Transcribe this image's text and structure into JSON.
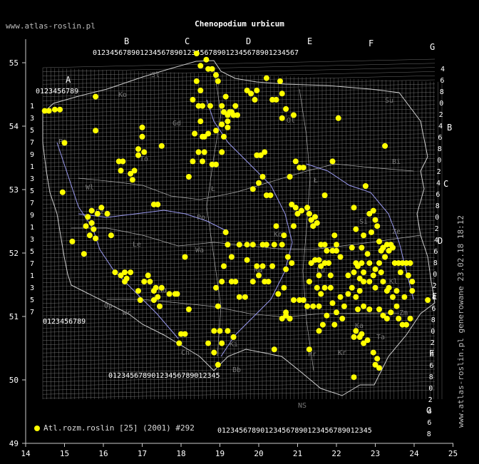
{
  "header": {
    "title": "Chenopodium urbicum",
    "site": "www.atlas-roslin.pl"
  },
  "side_note": "www.atlas-roslin.pl generowane 23.02.18 18:12",
  "legend": {
    "label": "Atl.rozm.roslin [25] (2001) #292"
  },
  "colors": {
    "point": "#ffff00",
    "grid": "#888888",
    "border": "#cccccc",
    "river": "#9999ee",
    "background": "#000000"
  },
  "axes": {
    "x_ticks": [
      "14",
      "15",
      "16",
      "17",
      "18",
      "19",
      "20",
      "21",
      "22",
      "23",
      "24",
      "25"
    ],
    "y_ticks": [
      "55",
      "54",
      "53",
      "52",
      "51",
      "50",
      "49"
    ]
  },
  "grid_letters": {
    "top": [
      "A",
      "B",
      "C",
      "D",
      "E",
      "F",
      "G"
    ],
    "right": [
      "B",
      "C",
      "D",
      "E",
      "F",
      "G"
    ],
    "digit_row": "0123456789"
  },
  "region_labels": [
    "Sl",
    "Ko",
    "Su",
    "Ol",
    "Gd",
    "To",
    "Bi",
    "Wl",
    "Ł",
    "Ł",
    "Po",
    "Ko",
    "Le",
    "Wa",
    "Ra",
    "Lu",
    "Kl",
    "Op",
    "Wr",
    "Ki",
    "Kr",
    "Zm",
    "NS",
    "Bb",
    "Sz",
    "Pi",
    "Si",
    "Ze",
    "Ka",
    "Ta",
    "Pr",
    "Ch",
    "Na"
  ],
  "map_data": {
    "species": "Chenopodium urbicum",
    "points": [
      [
        14.49,
        54.22
      ],
      [
        14.6,
        54.22
      ],
      [
        14.75,
        54.24
      ],
      [
        14.88,
        54.24
      ],
      [
        15.8,
        54.45
      ],
      [
        15.8,
        53.9
      ],
      [
        15.0,
        53.7
      ],
      [
        14.95,
        52.9
      ],
      [
        15.2,
        52.1
      ],
      [
        15.5,
        51.9
      ],
      [
        15.6,
        52.5
      ],
      [
        15.7,
        52.6
      ],
      [
        15.7,
        52.4
      ],
      [
        15.75,
        52.3
      ],
      [
        15.85,
        52.55
      ],
      [
        15.95,
        52.65
      ],
      [
        15.65,
        52.2
      ],
      [
        15.8,
        52.15
      ],
      [
        16.1,
        52.55
      ],
      [
        16.2,
        52.2
      ],
      [
        15.55,
        52.35
      ],
      [
        16.4,
        53.4
      ],
      [
        16.5,
        53.4
      ],
      [
        16.45,
        53.25
      ],
      [
        16.7,
        53.2
      ],
      [
        16.8,
        53.25
      ],
      [
        16.75,
        53.1
      ],
      [
        16.9,
        53.6
      ],
      [
        16.9,
        53.5
      ],
      [
        17.0,
        53.8
      ],
      [
        17.0,
        53.95
      ],
      [
        17.05,
        53.55
      ],
      [
        17.3,
        52.7
      ],
      [
        17.4,
        52.7
      ],
      [
        17.5,
        53.65
      ],
      [
        16.3,
        51.6
      ],
      [
        16.45,
        51.55
      ],
      [
        16.55,
        51.6
      ],
      [
        16.7,
        51.6
      ],
      [
        16.55,
        51.45
      ],
      [
        16.6,
        51.5
      ],
      [
        16.9,
        51.3
      ],
      [
        16.95,
        51.15
      ],
      [
        17.05,
        51.45
      ],
      [
        17.15,
        51.55
      ],
      [
        17.2,
        51.45
      ],
      [
        17.3,
        51.3
      ],
      [
        17.35,
        51.35
      ],
      [
        17.4,
        51.2
      ],
      [
        17.5,
        51.35
      ],
      [
        17.7,
        51.25
      ],
      [
        17.85,
        51.25
      ],
      [
        17.9,
        51.25
      ],
      [
        17.3,
        51.15
      ],
      [
        17.45,
        51.05
      ],
      [
        18.0,
        50.6
      ],
      [
        18.1,
        50.6
      ],
      [
        17.95,
        50.45
      ],
      [
        18.2,
        51.0
      ],
      [
        18.1,
        51.85
      ],
      [
        18.2,
        53.15
      ],
      [
        18.3,
        53.4
      ],
      [
        18.3,
        54.4
      ],
      [
        18.5,
        54.55
      ],
      [
        18.65,
        55.05
      ],
      [
        18.7,
        54.9
      ],
      [
        18.8,
        54.9
      ],
      [
        18.9,
        54.8
      ],
      [
        18.95,
        54.7
      ],
      [
        18.4,
        55.15
      ],
      [
        18.5,
        54.95
      ],
      [
        18.4,
        54.7
      ],
      [
        18.45,
        54.3
      ],
      [
        18.55,
        54.3
      ],
      [
        18.75,
        54.3
      ],
      [
        18.5,
        54.05
      ],
      [
        18.55,
        53.8
      ],
      [
        18.6,
        53.8
      ],
      [
        18.7,
        53.85
      ],
      [
        18.45,
        53.55
      ],
      [
        18.55,
        53.4
      ],
      [
        18.6,
        53.55
      ],
      [
        18.8,
        53.35
      ],
      [
        18.9,
        53.35
      ],
      [
        18.9,
        53.9
      ],
      [
        19.05,
        54.3
      ],
      [
        19.15,
        54.45
      ],
      [
        19.1,
        54.2
      ],
      [
        19.2,
        54.15
      ],
      [
        19.3,
        54.2
      ],
      [
        19.35,
        54.15
      ],
      [
        19.2,
        54.05
      ],
      [
        19.2,
        53.95
      ],
      [
        19.1,
        53.8
      ],
      [
        19.05,
        54.0
      ],
      [
        19.25,
        54.2
      ],
      [
        19.4,
        54.3
      ],
      [
        19.45,
        54.15
      ],
      [
        19.05,
        53.55
      ],
      [
        18.35,
        53.85
      ],
      [
        19.2,
        52.05
      ],
      [
        19.15,
        52.25
      ],
      [
        19.3,
        51.85
      ],
      [
        19.5,
        52.05
      ],
      [
        19.7,
        52.05
      ],
      [
        19.85,
        52.05
      ],
      [
        20.1,
        52.05
      ],
      [
        20.2,
        52.05
      ],
      [
        20.4,
        52.05
      ],
      [
        20.6,
        52.05
      ],
      [
        19.7,
        51.8
      ],
      [
        19.95,
        51.7
      ],
      [
        20.1,
        51.7
      ],
      [
        20.35,
        51.7
      ],
      [
        20.7,
        51.65
      ],
      [
        20.75,
        51.85
      ],
      [
        20.85,
        51.75
      ],
      [
        20.65,
        52.2
      ],
      [
        20.45,
        52.35
      ],
      [
        19.1,
        51.7
      ],
      [
        18.9,
        51.35
      ],
      [
        18.95,
        51.05
      ],
      [
        19.05,
        51.45
      ],
      [
        19.3,
        51.45
      ],
      [
        19.4,
        51.45
      ],
      [
        19.5,
        51.2
      ],
      [
        19.65,
        51.2
      ],
      [
        19.85,
        51.45
      ],
      [
        20.0,
        51.55
      ],
      [
        20.15,
        51.45
      ],
      [
        20.25,
        51.45
      ],
      [
        20.5,
        51.25
      ],
      [
        20.65,
        51.35
      ],
      [
        20.6,
        50.85
      ],
      [
        20.7,
        50.9
      ],
      [
        20.8,
        50.85
      ],
      [
        20.9,
        51.15
      ],
      [
        21.05,
        51.15
      ],
      [
        21.15,
        51.15
      ],
      [
        21.25,
        51.05
      ],
      [
        21.4,
        51.05
      ],
      [
        21.55,
        51.05
      ],
      [
        21.3,
        51.45
      ],
      [
        21.5,
        51.35
      ],
      [
        21.6,
        51.25
      ],
      [
        21.7,
        51.35
      ],
      [
        21.85,
        51.35
      ],
      [
        21.9,
        51.1
      ],
      [
        21.35,
        51.75
      ],
      [
        21.45,
        51.8
      ],
      [
        21.55,
        51.8
      ],
      [
        21.6,
        51.7
      ],
      [
        21.55,
        51.55
      ],
      [
        21.7,
        51.75
      ],
      [
        21.8,
        51.75
      ],
      [
        21.85,
        51.55
      ],
      [
        21.6,
        52.05
      ],
      [
        21.7,
        52.05
      ],
      [
        21.75,
        51.95
      ],
      [
        21.9,
        51.95
      ],
      [
        22.0,
        51.95
      ],
      [
        21.95,
        52.2
      ],
      [
        22.0,
        52.05
      ],
      [
        22.1,
        51.85
      ],
      [
        21.35,
        52.45
      ],
      [
        21.45,
        52.5
      ],
      [
        21.4,
        52.35
      ],
      [
        21.25,
        52.65
      ],
      [
        21.0,
        52.55
      ],
      [
        20.9,
        52.35
      ],
      [
        20.85,
        52.7
      ],
      [
        20.95,
        52.65
      ],
      [
        21.1,
        52.6
      ],
      [
        21.3,
        52.55
      ],
      [
        21.5,
        52.4
      ],
      [
        21.7,
        52.85
      ],
      [
        20.2,
        52.85
      ],
      [
        20.3,
        52.85
      ],
      [
        20.0,
        53.05
      ],
      [
        19.85,
        52.95
      ],
      [
        20.1,
        53.15
      ],
      [
        20.8,
        53.15
      ],
      [
        20.95,
        53.4
      ],
      [
        21.05,
        53.3
      ],
      [
        21.15,
        53.3
      ],
      [
        21.9,
        53.4
      ],
      [
        22.05,
        54.1
      ],
      [
        22.45,
        52.65
      ],
      [
        22.5,
        52.3
      ],
      [
        22.4,
        52.0
      ],
      [
        22.5,
        51.75
      ],
      [
        22.65,
        51.75
      ],
      [
        22.8,
        51.9
      ],
      [
        22.65,
        52.0
      ],
      [
        22.7,
        52.2
      ],
      [
        22.9,
        52.25
      ],
      [
        22.85,
        52.55
      ],
      [
        22.95,
        52.6
      ],
      [
        23.0,
        52.45
      ],
      [
        22.75,
        53.0
      ],
      [
        23.05,
        52.35
      ],
      [
        23.1,
        52.1
      ],
      [
        23.2,
        52.0
      ],
      [
        23.3,
        52.05
      ],
      [
        23.4,
        52.05
      ],
      [
        23.15,
        51.95
      ],
      [
        23.25,
        51.85
      ],
      [
        23.35,
        51.95
      ],
      [
        23.45,
        52.0
      ],
      [
        23.5,
        51.75
      ],
      [
        23.6,
        51.75
      ],
      [
        23.7,
        51.75
      ],
      [
        23.8,
        51.75
      ],
      [
        23.9,
        51.75
      ],
      [
        23.65,
        51.6
      ],
      [
        23.85,
        51.55
      ],
      [
        23.1,
        51.75
      ],
      [
        23.0,
        51.65
      ],
      [
        22.85,
        51.75
      ],
      [
        22.7,
        51.6
      ],
      [
        22.55,
        51.7
      ],
      [
        22.45,
        51.6
      ],
      [
        22.3,
        51.55
      ],
      [
        22.6,
        51.5
      ],
      [
        22.7,
        51.45
      ],
      [
        22.85,
        51.45
      ],
      [
        23.0,
        51.35
      ],
      [
        22.95,
        51.55
      ],
      [
        22.6,
        51.3
      ],
      [
        22.5,
        51.2
      ],
      [
        22.4,
        51.35
      ],
      [
        22.3,
        51.25
      ],
      [
        22.1,
        51.2
      ],
      [
        22.2,
        51.05
      ],
      [
        22.55,
        51.0
      ],
      [
        22.7,
        51.05
      ],
      [
        22.85,
        51.0
      ],
      [
        23.1,
        51.0
      ],
      [
        23.2,
        50.9
      ],
      [
        23.3,
        50.85
      ],
      [
        23.4,
        50.95
      ],
      [
        23.55,
        51.05
      ],
      [
        23.6,
        50.85
      ],
      [
        23.7,
        50.75
      ],
      [
        23.8,
        50.75
      ],
      [
        23.9,
        50.85
      ],
      [
        23.75,
        51.2
      ],
      [
        23.95,
        51.3
      ],
      [
        23.95,
        51.45
      ],
      [
        23.85,
        51.55
      ],
      [
        23.45,
        51.2
      ],
      [
        23.55,
        51.3
      ],
      [
        23.3,
        51.3
      ],
      [
        23.2,
        51.45
      ],
      [
        23.15,
        51.6
      ],
      [
        23.35,
        51.35
      ],
      [
        22.8,
        50.5
      ],
      [
        22.7,
        50.45
      ],
      [
        22.6,
        50.55
      ],
      [
        22.65,
        50.6
      ],
      [
        22.5,
        50.65
      ],
      [
        22.45,
        50.55
      ],
      [
        23.0,
        50.1
      ],
      [
        23.05,
        50.2
      ],
      [
        23.1,
        50.05
      ],
      [
        22.95,
        50.3
      ],
      [
        22.45,
        49.9
      ],
      [
        21.95,
        50.75
      ],
      [
        22.0,
        50.95
      ],
      [
        22.15,
        50.85
      ],
      [
        21.65,
        50.75
      ],
      [
        21.75,
        50.9
      ],
      [
        21.55,
        50.65
      ],
      [
        21.3,
        50.35
      ],
      [
        20.4,
        50.35
      ],
      [
        19.35,
        50.55
      ],
      [
        19.2,
        50.65
      ],
      [
        19.0,
        50.65
      ],
      [
        18.85,
        50.65
      ],
      [
        19.05,
        50.45
      ],
      [
        18.7,
        50.45
      ],
      [
        18.85,
        50.3
      ],
      [
        18.95,
        50.1
      ],
      [
        20.8,
        50.85
      ],
      [
        20.7,
        50.95
      ],
      [
        24.35,
        51.15
      ],
      [
        23.25,
        53.65
      ],
      [
        20.45,
        54.4
      ],
      [
        20.35,
        54.4
      ],
      [
        20.55,
        54.7
      ],
      [
        20.6,
        54.5
      ],
      [
        19.95,
        54.55
      ],
      [
        19.8,
        54.5
      ],
      [
        19.7,
        54.55
      ],
      [
        20.2,
        54.75
      ],
      [
        20.05,
        53.5
      ],
      [
        19.95,
        53.5
      ],
      [
        20.15,
        53.55
      ],
      [
        20.6,
        54.1
      ],
      [
        20.7,
        54.25
      ],
      [
        20.9,
        54.15
      ],
      [
        19.9,
        54.4
      ]
    ]
  }
}
